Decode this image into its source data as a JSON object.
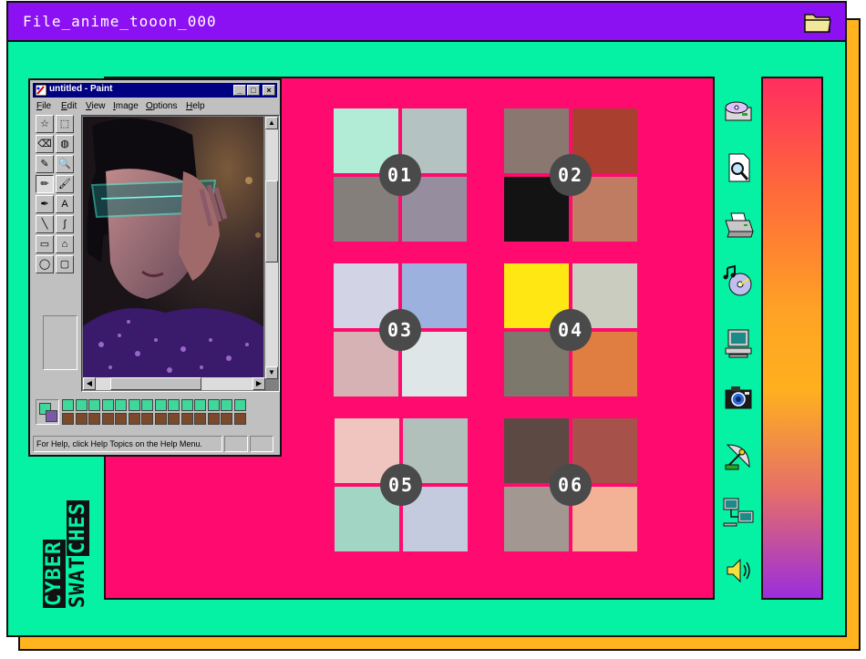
{
  "window": {
    "title": "File_anime_tooon_000"
  },
  "brand": {
    "word1": "CYBER",
    "word2_plain": "SWAT",
    "word2_highlight": "CHES"
  },
  "swatches": [
    {
      "label": "01",
      "colors": [
        "#b3ecd6",
        "#b4c2c1",
        "#857f7b",
        "#968d9e"
      ]
    },
    {
      "label": "02",
      "colors": [
        "#8a7870",
        "#a9402f",
        "#141313",
        "#c07c62"
      ]
    },
    {
      "label": "03",
      "colors": [
        "#d2d4e5",
        "#9cb1de",
        "#d7b2b4",
        "#dfe6e8"
      ]
    },
    {
      "label": "04",
      "colors": [
        "#ffe713",
        "#c9ccbf",
        "#7d786c",
        "#e07e42"
      ]
    },
    {
      "label": "05",
      "colors": [
        "#f0c4bf",
        "#b2c0bb",
        "#a3d5c5",
        "#c5cbdf"
      ]
    },
    {
      "label": "06",
      "colors": [
        "#5c4943",
        "#a6524a",
        "#a39791",
        "#f3b296"
      ]
    }
  ],
  "side_icons": [
    "cd-drive-icon",
    "find-document-icon",
    "printer-icon",
    "music-cd-icon",
    "computer-icon",
    "camera-icon",
    "satellite-dish-icon",
    "network-computers-icon",
    "speaker-icon"
  ],
  "paint": {
    "title": "untitled - Paint",
    "minimize": "_",
    "maximize": "□",
    "close": "×",
    "menu": [
      {
        "ul": "F",
        "rest": "ile"
      },
      {
        "ul": "E",
        "rest": "dit"
      },
      {
        "ul": "V",
        "rest": "iew"
      },
      {
        "ul": "I",
        "rest": "mage"
      },
      {
        "ul": "O",
        "rest": "ptions"
      },
      {
        "ul": "H",
        "rest": "elp"
      }
    ],
    "tools": [
      "☆",
      "⬚",
      "⌫",
      "◍",
      "✎",
      "🔍",
      "✏",
      "🖌",
      "✒",
      "A",
      "╲",
      "∫",
      "▭",
      "⌂",
      "◯",
      "▢"
    ],
    "status": "For Help, click Help Topics on the Help Menu.",
    "palette_top": [
      "#3fd89a",
      "#3fd89a",
      "#3fd89a",
      "#3fd89a",
      "#3fd89a",
      "#3fd89a",
      "#3fd89a",
      "#3fd89a",
      "#3fd89a",
      "#3fd89a",
      "#3fd89a",
      "#3fd89a",
      "#3fd89a",
      "#3fd89a"
    ],
    "palette_bottom": [
      "#7a4a2a",
      "#7a4a2a",
      "#7a4a2a",
      "#7a4a2a",
      "#7a4a2a",
      "#7a4a2a",
      "#7a4a2a",
      "#7a4a2a",
      "#7a4a2a",
      "#7a4a2a",
      "#7a4a2a",
      "#7a4a2a",
      "#7a4a2a",
      "#7a4a2a"
    ]
  },
  "colors": {
    "background": "#05f2a5",
    "titlebar": "#8b10f2",
    "panel": "#ff0a6e",
    "shadow": "#ffb31f",
    "badge": "#4a4a4a"
  }
}
